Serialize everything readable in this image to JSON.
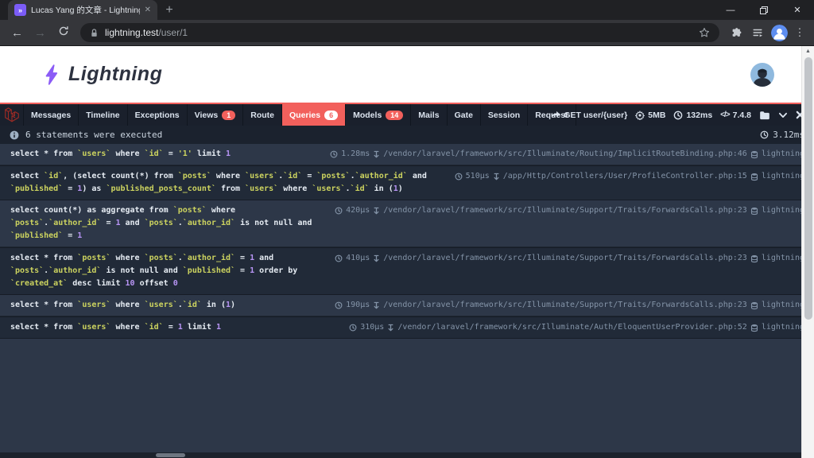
{
  "browser": {
    "tab_title": "Lucas Yang 的文章 - Lightning",
    "favicon_glyph": "»",
    "url_domain": "lightning.test",
    "url_path": "/user/1"
  },
  "header": {
    "brand": "Lightning"
  },
  "debugbar": {
    "tabs": [
      {
        "label": "Messages"
      },
      {
        "label": "Timeline"
      },
      {
        "label": "Exceptions"
      },
      {
        "label": "Views",
        "badge": "1"
      },
      {
        "label": "Route"
      },
      {
        "label": "Queries",
        "badge": "6",
        "active": true
      },
      {
        "label": "Models",
        "badge": "14"
      },
      {
        "label": "Mails"
      },
      {
        "label": "Gate"
      },
      {
        "label": "Session"
      },
      {
        "label": "Request"
      }
    ],
    "info": [
      {
        "icon": "share-arrow-icon",
        "label": "GET user/{user}"
      },
      {
        "icon": "cogs-icon",
        "label": "5MB"
      },
      {
        "icon": "clock-icon",
        "label": "132ms"
      },
      {
        "icon": "code-icon",
        "label": "7.4.8"
      }
    ]
  },
  "statusbar": {
    "message": "6 statements were executed",
    "total_time": "3.12ms"
  },
  "queries": [
    {
      "sql": [
        {
          "c": "kw",
          "t": "select * from "
        },
        {
          "c": "id",
          "t": "`users`"
        },
        {
          "c": "kw",
          "t": " where "
        },
        {
          "c": "id",
          "t": "`id`"
        },
        {
          "c": "kw",
          "t": " = "
        },
        {
          "c": "str",
          "t": "'1'"
        },
        {
          "c": "kw",
          "t": " limit "
        },
        {
          "c": "num",
          "t": "1"
        }
      ],
      "time": "1.28ms",
      "file": "/vendor/laravel/framework/src/Illuminate/Routing/ImplicitRouteBinding.php:46",
      "connection": "lightning"
    },
    {
      "sql": [
        {
          "c": "kw",
          "t": "select "
        },
        {
          "c": "id",
          "t": "`id`"
        },
        {
          "c": "kw",
          "t": ", (select count(*) from "
        },
        {
          "c": "id",
          "t": "`posts`"
        },
        {
          "c": "kw",
          "t": " where "
        },
        {
          "c": "id",
          "t": "`users`"
        },
        {
          "c": "kw",
          "t": "."
        },
        {
          "c": "id",
          "t": "`id`"
        },
        {
          "c": "kw",
          "t": " = "
        },
        {
          "c": "id",
          "t": "`posts`"
        },
        {
          "c": "kw",
          "t": "."
        },
        {
          "c": "id",
          "t": "`author_id`"
        },
        {
          "c": "kw",
          "t": " and "
        },
        {
          "c": "id",
          "t": "`published`"
        },
        {
          "c": "kw",
          "t": " = "
        },
        {
          "c": "num",
          "t": "1"
        },
        {
          "c": "kw",
          "t": ") as "
        },
        {
          "c": "id",
          "t": "`published_posts_count`"
        },
        {
          "c": "kw",
          "t": " from "
        },
        {
          "c": "id",
          "t": "`users`"
        },
        {
          "c": "kw",
          "t": " where "
        },
        {
          "c": "id",
          "t": "`users`"
        },
        {
          "c": "kw",
          "t": "."
        },
        {
          "c": "id",
          "t": "`id`"
        },
        {
          "c": "kw",
          "t": " in ("
        },
        {
          "c": "num",
          "t": "1"
        },
        {
          "c": "kw",
          "t": ")"
        }
      ],
      "time": "510µs",
      "file": "/app/Http/Controllers/User/ProfileController.php:15",
      "connection": "lightning"
    },
    {
      "sql": [
        {
          "c": "kw",
          "t": "select count(*) as aggregate from "
        },
        {
          "c": "id",
          "t": "`posts`"
        },
        {
          "c": "kw",
          "t": " where "
        },
        {
          "c": "id",
          "t": "`posts`"
        },
        {
          "c": "kw",
          "t": "."
        },
        {
          "c": "id",
          "t": "`author_id`"
        },
        {
          "c": "kw",
          "t": " = "
        },
        {
          "c": "num",
          "t": "1"
        },
        {
          "c": "kw",
          "t": " and "
        },
        {
          "c": "id",
          "t": "`posts`"
        },
        {
          "c": "kw",
          "t": "."
        },
        {
          "c": "id",
          "t": "`author_id`"
        },
        {
          "c": "kw",
          "t": " is not null and "
        },
        {
          "c": "id",
          "t": "`published`"
        },
        {
          "c": "kw",
          "t": " = "
        },
        {
          "c": "num",
          "t": "1"
        }
      ],
      "time": "420µs",
      "file": "/vendor/laravel/framework/src/Illuminate/Support/Traits/ForwardsCalls.php:23",
      "connection": "lightning"
    },
    {
      "sql": [
        {
          "c": "kw",
          "t": "select * from "
        },
        {
          "c": "id",
          "t": "`posts`"
        },
        {
          "c": "kw",
          "t": " where "
        },
        {
          "c": "id",
          "t": "`posts`"
        },
        {
          "c": "kw",
          "t": "."
        },
        {
          "c": "id",
          "t": "`author_id`"
        },
        {
          "c": "kw",
          "t": " = "
        },
        {
          "c": "num",
          "t": "1"
        },
        {
          "c": "kw",
          "t": " and "
        },
        {
          "c": "id",
          "t": "`posts`"
        },
        {
          "c": "kw",
          "t": "."
        },
        {
          "c": "id",
          "t": "`author_id`"
        },
        {
          "c": "kw",
          "t": " is not null and "
        },
        {
          "c": "id",
          "t": "`published`"
        },
        {
          "c": "kw",
          "t": " = "
        },
        {
          "c": "num",
          "t": "1"
        },
        {
          "c": "kw",
          "t": " order by "
        },
        {
          "c": "id",
          "t": "`created_at`"
        },
        {
          "c": "kw",
          "t": " desc limit "
        },
        {
          "c": "num",
          "t": "10"
        },
        {
          "c": "kw",
          "t": " offset "
        },
        {
          "c": "num",
          "t": "0"
        }
      ],
      "time": "410µs",
      "file": "/vendor/laravel/framework/src/Illuminate/Support/Traits/ForwardsCalls.php:23",
      "connection": "lightning"
    },
    {
      "sql": [
        {
          "c": "kw",
          "t": "select * from "
        },
        {
          "c": "id",
          "t": "`users`"
        },
        {
          "c": "kw",
          "t": " where "
        },
        {
          "c": "id",
          "t": "`users`"
        },
        {
          "c": "kw",
          "t": "."
        },
        {
          "c": "id",
          "t": "`id`"
        },
        {
          "c": "kw",
          "t": " in ("
        },
        {
          "c": "num",
          "t": "1"
        },
        {
          "c": "kw",
          "t": ")"
        }
      ],
      "time": "190µs",
      "file": "/vendor/laravel/framework/src/Illuminate/Support/Traits/ForwardsCalls.php:23",
      "connection": "lightning"
    },
    {
      "sql": [
        {
          "c": "kw",
          "t": "select * from "
        },
        {
          "c": "id",
          "t": "`users`"
        },
        {
          "c": "kw",
          "t": " where "
        },
        {
          "c": "id",
          "t": "`id`"
        },
        {
          "c": "kw",
          "t": " = "
        },
        {
          "c": "num",
          "t": "1"
        },
        {
          "c": "kw",
          "t": " limit "
        },
        {
          "c": "num",
          "t": "1"
        }
      ],
      "time": "310µs",
      "file": "/vendor/laravel/framework/src/Illuminate/Auth/EloquentUserProvider.php:52",
      "connection": "lightning"
    }
  ],
  "colors": {
    "accent_red": "#f2605c",
    "bar_bg": "#1a202c",
    "panel_bg": "#2d3748",
    "sql_identifier": "#ccd35f",
    "sql_number": "#b794f4",
    "brand_purple": "#8b5cf6"
  }
}
